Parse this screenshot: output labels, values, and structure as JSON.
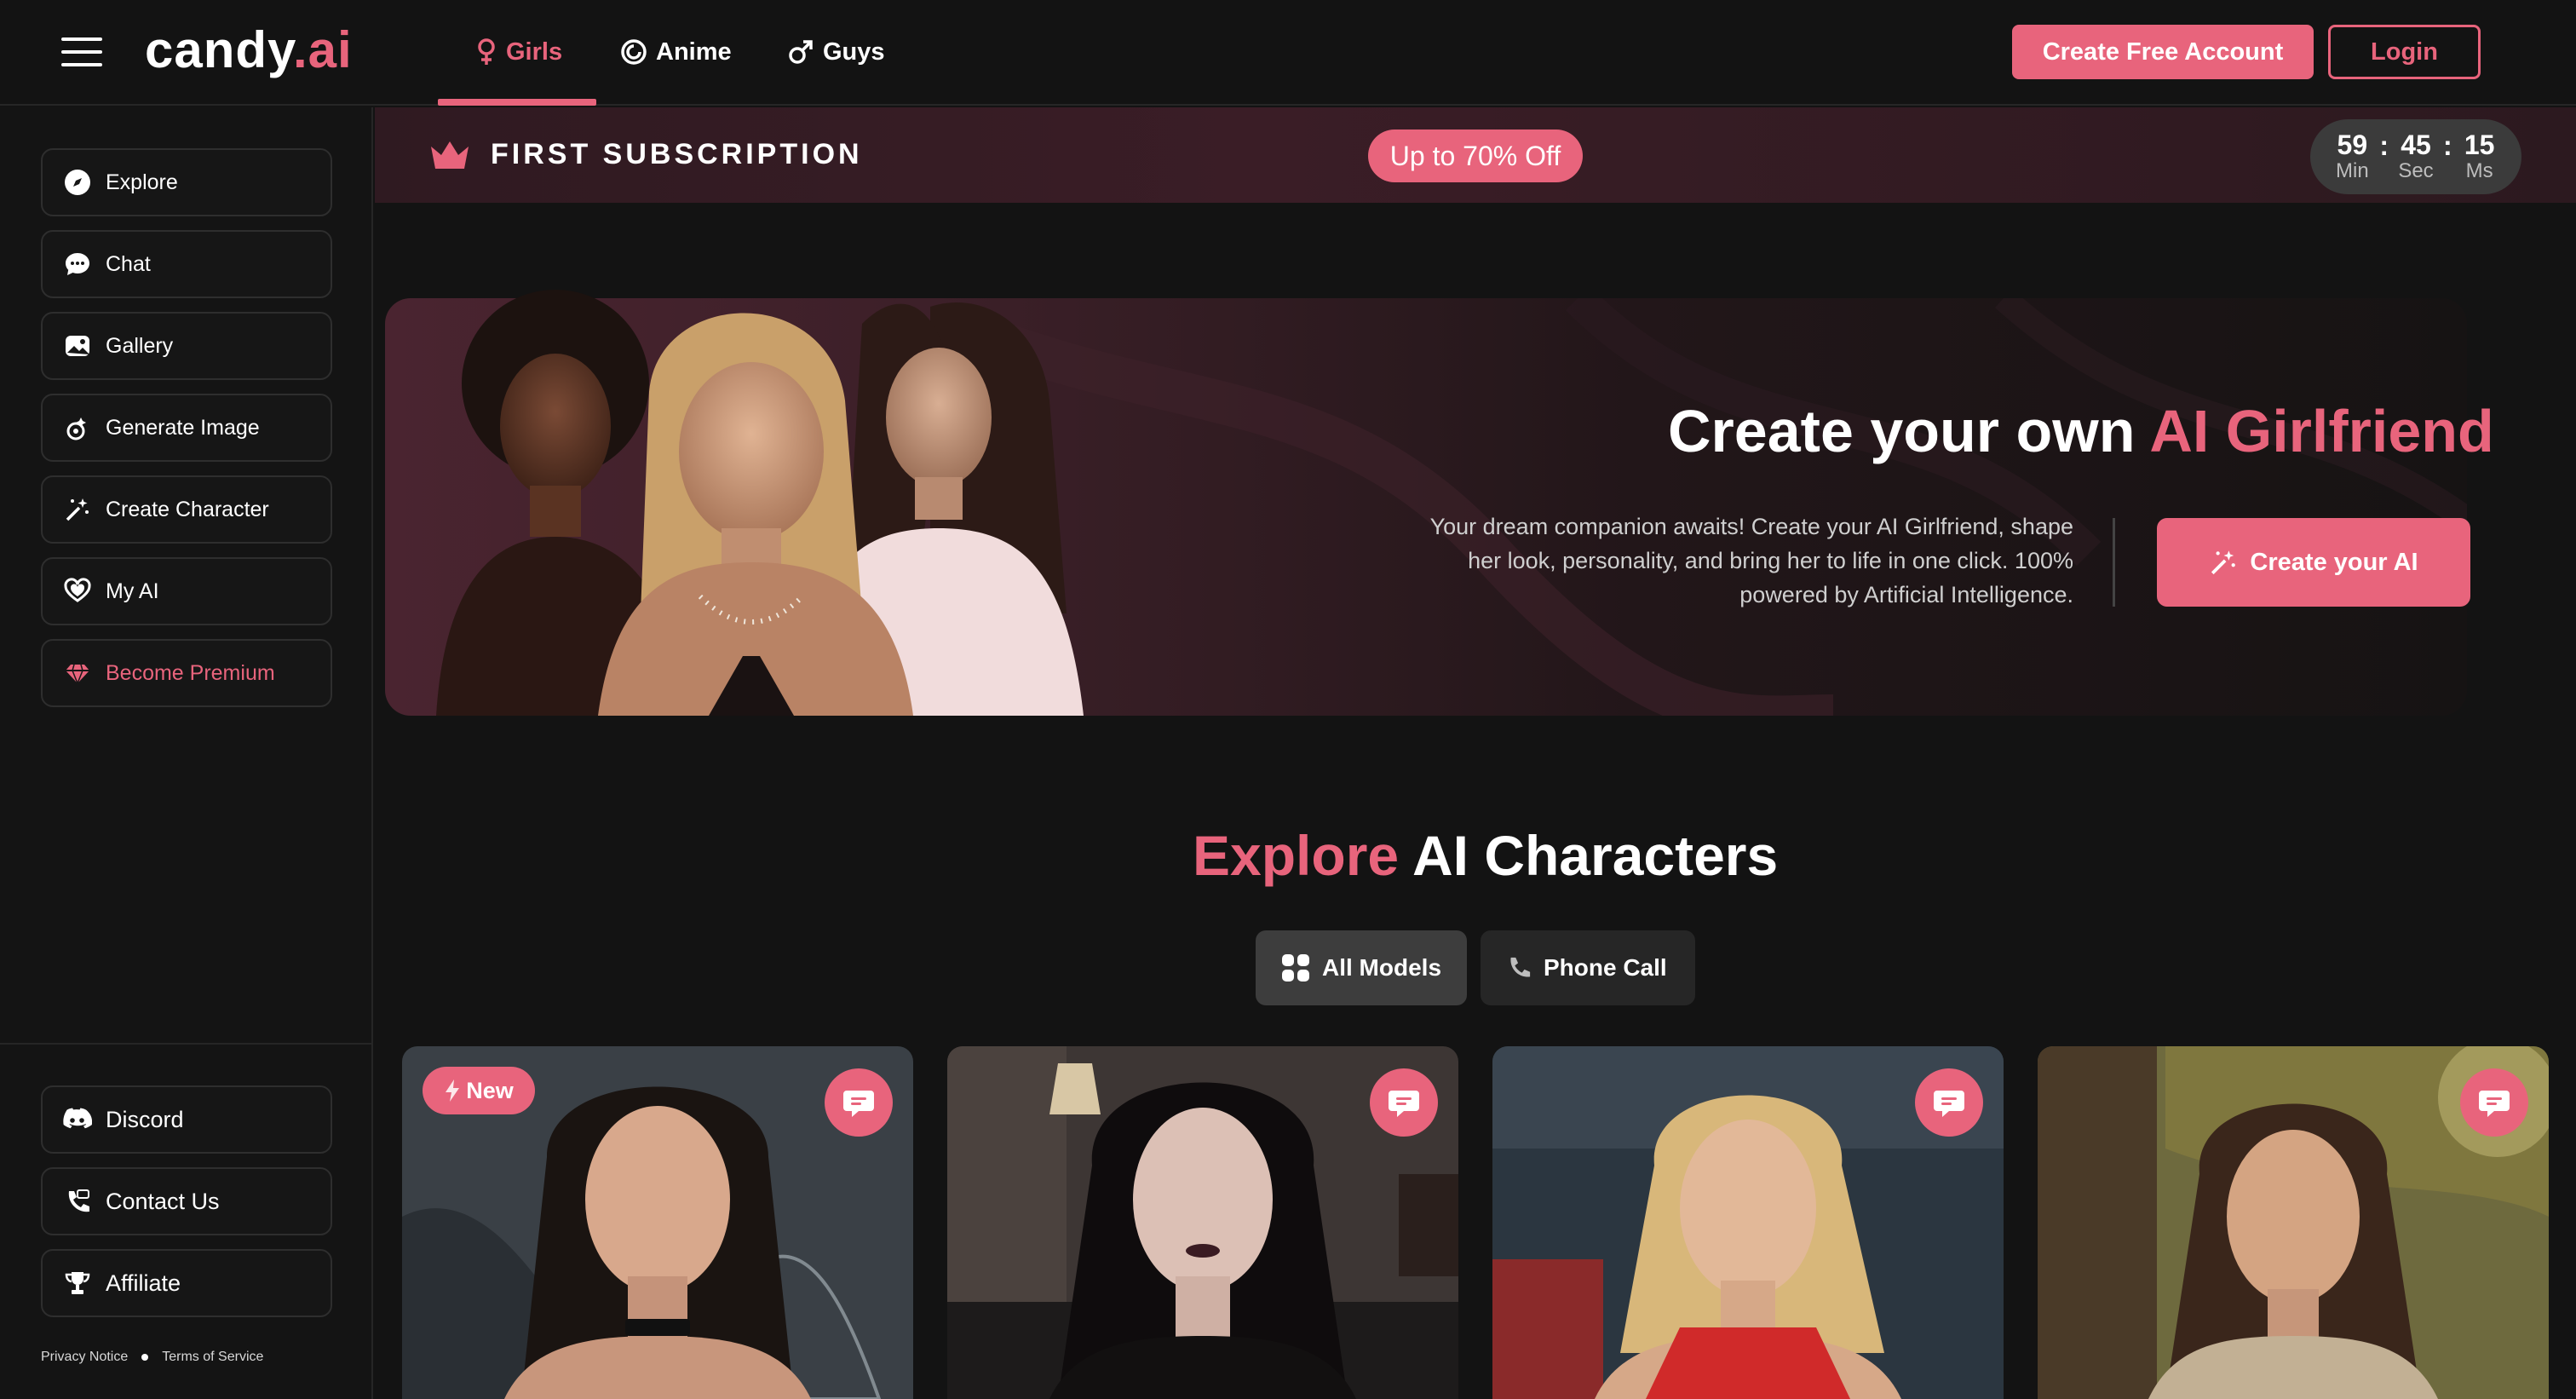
{
  "brand": {
    "logo_main": "candy",
    "logo_ai": ".ai"
  },
  "nav": {
    "tabs": [
      {
        "label": "Girls",
        "icon": "female-icon",
        "active": true
      },
      {
        "label": "Anime",
        "icon": "anime-swirl-icon",
        "active": false
      },
      {
        "label": "Guys",
        "icon": "male-icon",
        "active": false
      }
    ],
    "create_account": "Create Free Account",
    "login": "Login"
  },
  "sidebar": {
    "items": [
      {
        "label": "Explore",
        "icon": "compass-icon"
      },
      {
        "label": "Chat",
        "icon": "chat-bubble-icon"
      },
      {
        "label": "Gallery",
        "icon": "gallery-icon"
      },
      {
        "label": "Generate Image",
        "icon": "generate-image-icon"
      },
      {
        "label": "Create Character",
        "icon": "magic-wand-icon"
      },
      {
        "label": "My AI",
        "icon": "heart-hands-icon"
      },
      {
        "label": "Become Premium",
        "icon": "diamond-icon"
      }
    ],
    "footer_items": [
      {
        "label": "Discord",
        "icon": "discord-icon"
      },
      {
        "label": "Contact Us",
        "icon": "contact-icon"
      },
      {
        "label": "Affiliate",
        "icon": "trophy-icon"
      }
    ],
    "privacy": "Privacy Notice",
    "terms": "Terms of Service"
  },
  "promo": {
    "title": "FIRST SUBSCRIPTION",
    "badge": "Up to 70% Off",
    "timer": {
      "min": "59",
      "sec": "45",
      "ms": "15",
      "min_label": "Min",
      "sec_label": "Sec",
      "ms_label": "Ms"
    }
  },
  "hero": {
    "title_white": "Create your own ",
    "title_pink": "AI Girlfriend",
    "description": "Your dream companion awaits! Create your AI Girlfriend, shape her look, personality, and bring her to life in one click. 100% powered by Artificial Intelligence.",
    "cta": "Create your AI"
  },
  "explore": {
    "title_pink": "Explore",
    "title_white": " AI Characters",
    "filters": [
      "All Models",
      "Phone Call"
    ],
    "new_badge": "New"
  },
  "colors": {
    "accent": "#e8647c",
    "background": "#131313"
  }
}
